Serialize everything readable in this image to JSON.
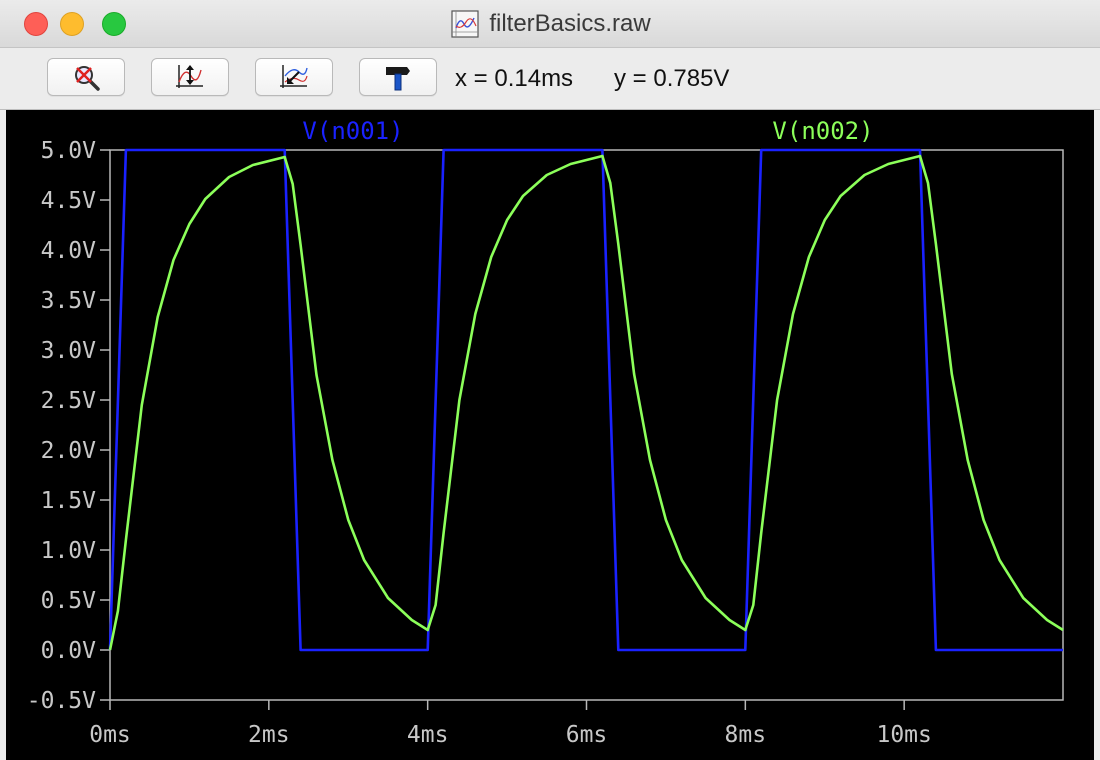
{
  "window": {
    "title": "filterBasics.raw",
    "icon": "waveform-document-icon"
  },
  "toolbar": {
    "buttons": [
      {
        "icon": "zoom-cancel-icon"
      },
      {
        "icon": "autorange-icon"
      },
      {
        "icon": "zoom-back-icon"
      },
      {
        "icon": "hammer-icon"
      }
    ],
    "cursor_x": "x = 0.14ms",
    "cursor_y": "y = 0.785V"
  },
  "colors": {
    "background": "#000000",
    "axis": "#b8b8b8",
    "tick_label": "#c8c8c8",
    "series_1": "#1a22ff",
    "series_2": "#8cff5a"
  },
  "chart_data": {
    "type": "line",
    "xlim": [
      0,
      12
    ],
    "ylim": [
      -0.5,
      5.0
    ],
    "x_ticks": [
      0,
      2,
      4,
      6,
      8,
      10
    ],
    "x_tick_labels": [
      "0ms",
      "2ms",
      "4ms",
      "6ms",
      "8ms",
      "10ms"
    ],
    "y_ticks": [
      5.0,
      4.5,
      4.0,
      3.5,
      3.0,
      2.5,
      2.0,
      1.5,
      1.0,
      0.5,
      0.0,
      -0.5
    ],
    "y_tick_labels": [
      "5.0V",
      "4.5V",
      "4.0V",
      "3.5V",
      "3.0V",
      "2.5V",
      "2.0V",
      "1.5V",
      "1.0V",
      "0.5V",
      "0.0V",
      "-0.5V"
    ],
    "grid": false,
    "series": [
      {
        "name": "V(n001)",
        "color": "#1a22ff",
        "x": [
          0,
          0.2,
          2.2,
          2.4,
          4.0,
          4.2,
          6.2,
          6.4,
          8.0,
          8.2,
          10.2,
          10.4,
          12
        ],
        "y": [
          0,
          5,
          5,
          0,
          0,
          5,
          5,
          0,
          0,
          5,
          5,
          0,
          0
        ]
      },
      {
        "name": "V(n002)",
        "color": "#8cff5a",
        "x": [
          0,
          0.1,
          0.2,
          0.4,
          0.6,
          0.8,
          1.0,
          1.2,
          1.5,
          1.8,
          2.2,
          2.3,
          2.4,
          2.6,
          2.8,
          3.0,
          3.2,
          3.5,
          3.8,
          4.0,
          4.1,
          4.2,
          4.4,
          4.6,
          4.8,
          5.0,
          5.2,
          5.5,
          5.8,
          6.2,
          6.3,
          6.4,
          6.6,
          6.8,
          7.0,
          7.2,
          7.5,
          7.8,
          8.0,
          8.1,
          8.2,
          8.4,
          8.6,
          8.8,
          9.0,
          9.2,
          9.5,
          9.8,
          10.2,
          10.3,
          10.4,
          10.6,
          10.8,
          11.0,
          11.2,
          11.5,
          11.8,
          12.0
        ],
        "y": [
          0.0,
          0.39,
          1.1,
          2.45,
          3.33,
          3.9,
          4.26,
          4.51,
          4.73,
          4.85,
          4.93,
          4.66,
          4.05,
          2.75,
          1.9,
          1.3,
          0.9,
          0.52,
          0.3,
          0.2,
          0.45,
          1.17,
          2.5,
          3.36,
          3.93,
          4.3,
          4.54,
          4.75,
          4.86,
          4.94,
          4.67,
          4.06,
          2.76,
          1.9,
          1.3,
          0.9,
          0.52,
          0.3,
          0.2,
          0.45,
          1.17,
          2.5,
          3.36,
          3.93,
          4.3,
          4.54,
          4.75,
          4.86,
          4.94,
          4.67,
          4.06,
          2.76,
          1.9,
          1.3,
          0.9,
          0.52,
          0.3,
          0.2
        ]
      }
    ]
  }
}
